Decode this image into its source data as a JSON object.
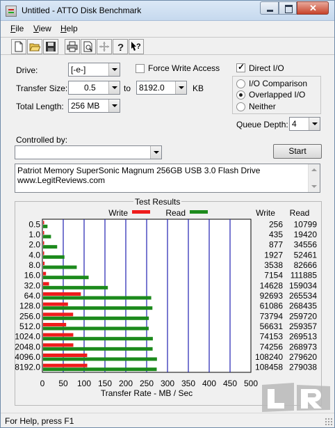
{
  "window": {
    "title": "Untitled - ATTO Disk Benchmark"
  },
  "menu": [
    "File",
    "View",
    "Help"
  ],
  "toolbar": {
    "icons": [
      "new-file-icon",
      "open-folder-icon",
      "save-disk-icon",
      "print-icon",
      "print-preview-icon",
      "move-crosshair-icon",
      "help-icon",
      "context-help-icon"
    ]
  },
  "form": {
    "drive_label": "Drive:",
    "drive_value": "[-e-]",
    "force_write_label": "Force Write Access",
    "force_write_checked": false,
    "direct_io_label": "Direct I/O",
    "direct_io_checked": true,
    "transfer_size_label": "Transfer Size:",
    "transfer_from": "0.5",
    "to_label": "to",
    "transfer_to": "8192.0",
    "kb_label": "KB",
    "total_length_label": "Total Length:",
    "total_length_value": "256 MB",
    "io_comparison_label": "I/O Comparison",
    "overlapped_io_label": "Overlapped I/O",
    "neither_label": "Neither",
    "selected_mode": "Overlapped I/O",
    "queue_depth_label": "Queue Depth:",
    "queue_depth_value": "4",
    "controlled_by_label": "Controlled by:",
    "controlled_by_value": "",
    "start_label": "Start"
  },
  "description": {
    "line1": "Patriot Memory SuperSonic Magnum 256GB USB 3.0 Flash Drive",
    "line2": "www.LegitReviews.com"
  },
  "status": {
    "text": "For Help, press F1"
  },
  "colors": {
    "write": "#ef1c1c",
    "read": "#1c8a1c",
    "grid": "#1f1fb0"
  },
  "chart_data": {
    "type": "bar",
    "orientation": "horizontal",
    "title": "Test Results",
    "xlabel": "Transfer Rate - MB / Sec",
    "xlim": [
      0,
      500
    ],
    "xticks": [
      "0",
      "50",
      "100",
      "150",
      "200",
      "250",
      "300",
      "350",
      "400",
      "450",
      "500"
    ],
    "legend": [
      "Write",
      "Read"
    ],
    "categories": [
      "0.5",
      "1.0",
      "2.0",
      "4.0",
      "8.0",
      "16.0",
      "32.0",
      "64.0",
      "128.0",
      "256.0",
      "512.0",
      "1024.0",
      "2048.0",
      "4096.0",
      "8192.0"
    ],
    "series": [
      {
        "name": "Write",
        "values": [
          256,
          435,
          877,
          1927,
          3538,
          7154,
          14628,
          92693,
          61086,
          73794,
          56631,
          74153,
          74256,
          108240,
          108458
        ]
      },
      {
        "name": "Read",
        "values": [
          10799,
          19420,
          34556,
          52461,
          82666,
          111885,
          159034,
          265534,
          268435,
          259720,
          259357,
          269513,
          268973,
          279620,
          279038
        ]
      }
    ],
    "column_headers": [
      "Write",
      "Read"
    ]
  },
  "logo": {
    "text": "LR"
  }
}
